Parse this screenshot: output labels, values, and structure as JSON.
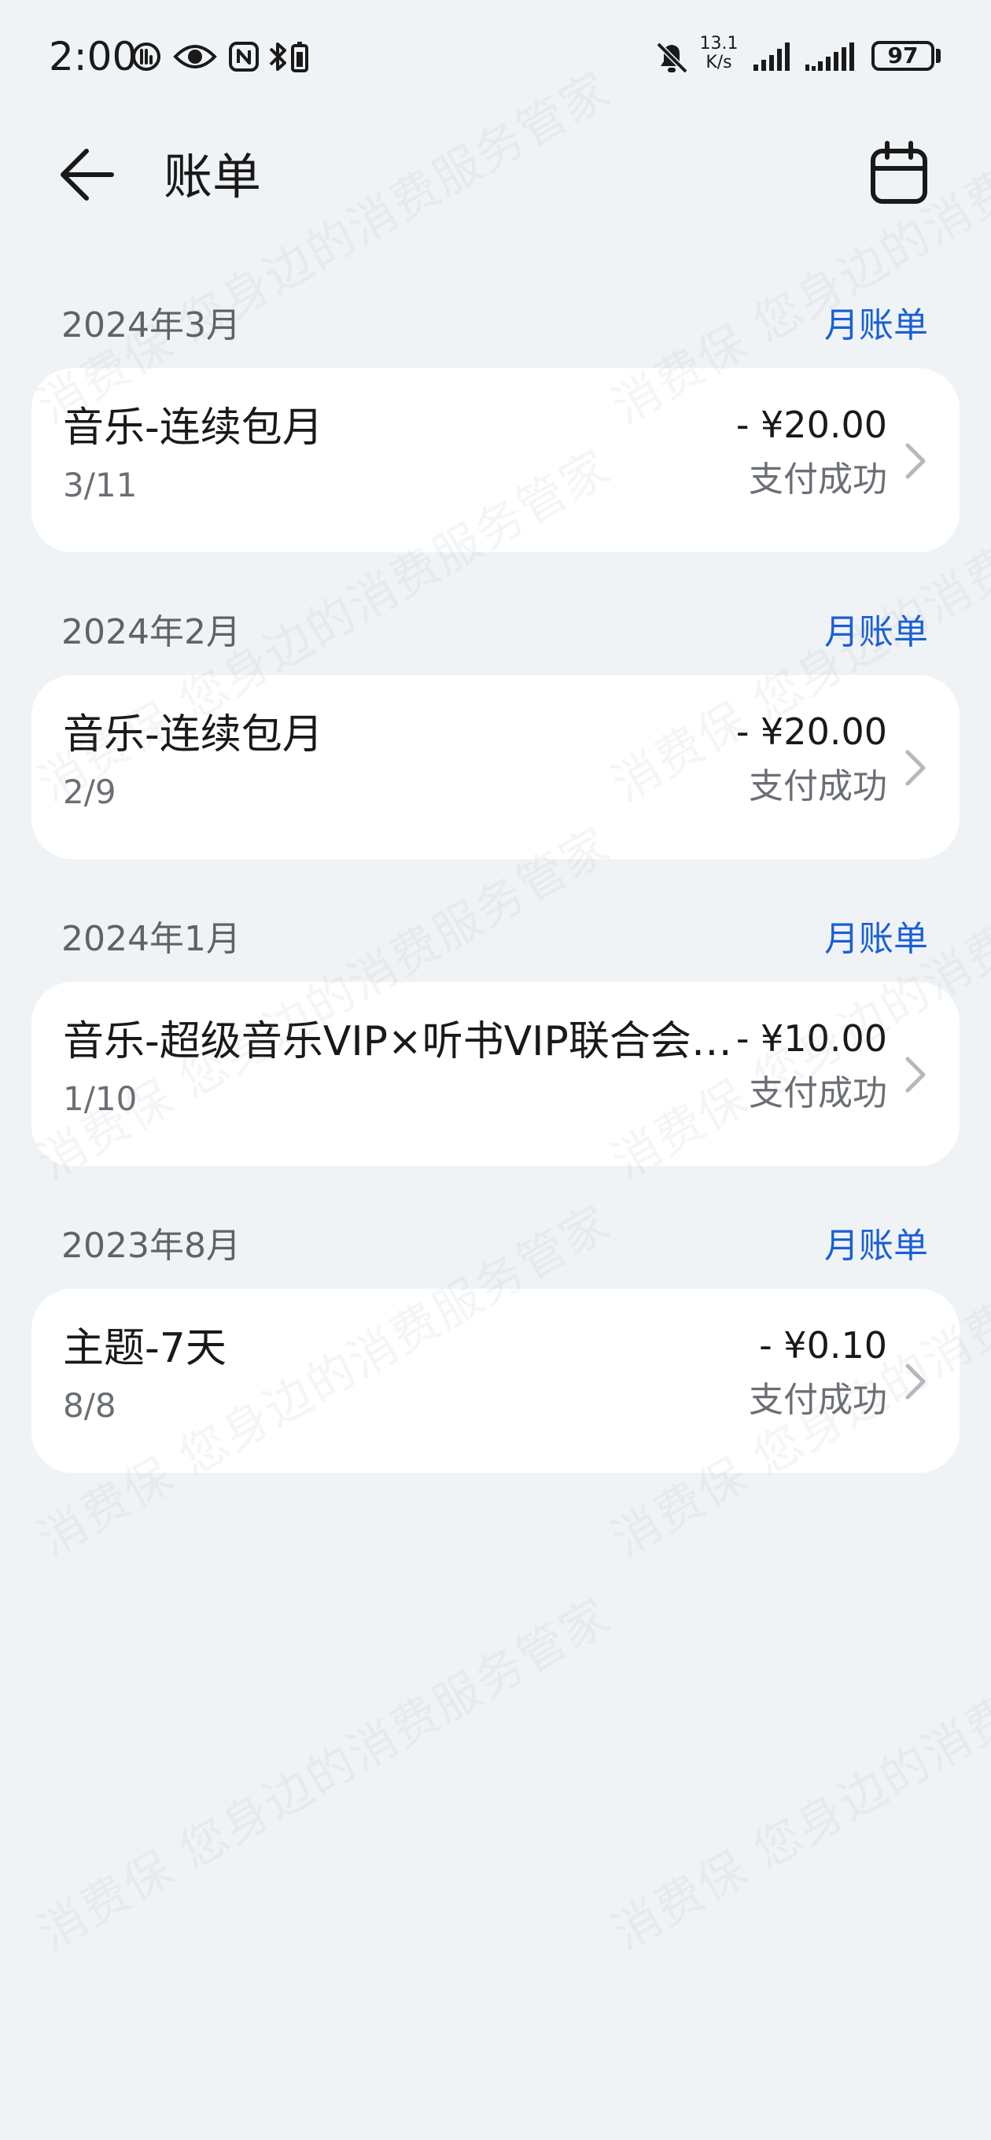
{
  "status_bar": {
    "time": "2:00",
    "net_speed_value": "13.1",
    "net_speed_unit": "K/s",
    "battery": "97",
    "icons": [
      "data-saver-icon",
      "eye-icon",
      "nfc-icon",
      "bluetooth-battery-icon",
      "mute-bell-icon",
      "signal-icon",
      "signal-secondary-icon",
      "battery-icon"
    ]
  },
  "header": {
    "title": "账单",
    "back_icon": "arrow-left-icon",
    "calendar_icon": "calendar-icon"
  },
  "sections": [
    {
      "month": "2024年3月",
      "link": "月账单",
      "items": [
        {
          "name": "音乐-连续包月",
          "date": "3/11",
          "amount": "- ¥20.00",
          "status": "支付成功"
        }
      ]
    },
    {
      "month": "2024年2月",
      "link": "月账单",
      "items": [
        {
          "name": "音乐-连续包月",
          "date": "2/9",
          "amount": "- ¥20.00",
          "status": "支付成功"
        }
      ]
    },
    {
      "month": "2024年1月",
      "link": "月账单",
      "items": [
        {
          "name": "音乐-超级音乐VIP×听书VIP联合会…",
          "date": "1/10",
          "amount": "- ¥10.00",
          "status": "支付成功"
        }
      ]
    },
    {
      "month": "2023年8月",
      "link": "月账单",
      "items": [
        {
          "name": "主题-7天",
          "date": "8/8",
          "amount": "- ¥0.10",
          "status": "支付成功"
        }
      ]
    }
  ],
  "watermark": "消费保 您身边的消费服务管家",
  "colors": {
    "background": "#f0f3f6",
    "card": "#ffffff",
    "link": "#1a5fd6",
    "secondary_text": "#6b6f75"
  }
}
